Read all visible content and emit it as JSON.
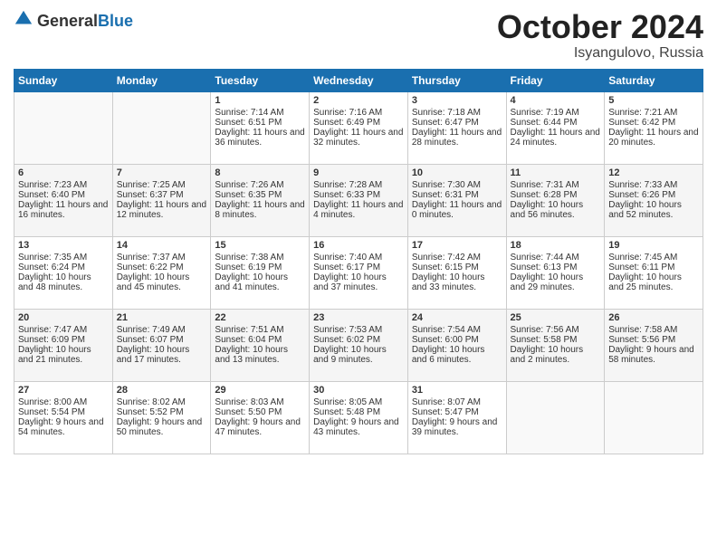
{
  "header": {
    "logo_general": "General",
    "logo_blue": "Blue",
    "month_title": "October 2024",
    "location": "Isyangulovo, Russia"
  },
  "weekdays": [
    "Sunday",
    "Monday",
    "Tuesday",
    "Wednesday",
    "Thursday",
    "Friday",
    "Saturday"
  ],
  "weeks": [
    [
      {
        "day": "",
        "sunrise": "",
        "sunset": "",
        "daylight": ""
      },
      {
        "day": "",
        "sunrise": "",
        "sunset": "",
        "daylight": ""
      },
      {
        "day": "1",
        "sunrise": "Sunrise: 7:14 AM",
        "sunset": "Sunset: 6:51 PM",
        "daylight": "Daylight: 11 hours and 36 minutes."
      },
      {
        "day": "2",
        "sunrise": "Sunrise: 7:16 AM",
        "sunset": "Sunset: 6:49 PM",
        "daylight": "Daylight: 11 hours and 32 minutes."
      },
      {
        "day": "3",
        "sunrise": "Sunrise: 7:18 AM",
        "sunset": "Sunset: 6:47 PM",
        "daylight": "Daylight: 11 hours and 28 minutes."
      },
      {
        "day": "4",
        "sunrise": "Sunrise: 7:19 AM",
        "sunset": "Sunset: 6:44 PM",
        "daylight": "Daylight: 11 hours and 24 minutes."
      },
      {
        "day": "5",
        "sunrise": "Sunrise: 7:21 AM",
        "sunset": "Sunset: 6:42 PM",
        "daylight": "Daylight: 11 hours and 20 minutes."
      }
    ],
    [
      {
        "day": "6",
        "sunrise": "Sunrise: 7:23 AM",
        "sunset": "Sunset: 6:40 PM",
        "daylight": "Daylight: 11 hours and 16 minutes."
      },
      {
        "day": "7",
        "sunrise": "Sunrise: 7:25 AM",
        "sunset": "Sunset: 6:37 PM",
        "daylight": "Daylight: 11 hours and 12 minutes."
      },
      {
        "day": "8",
        "sunrise": "Sunrise: 7:26 AM",
        "sunset": "Sunset: 6:35 PM",
        "daylight": "Daylight: 11 hours and 8 minutes."
      },
      {
        "day": "9",
        "sunrise": "Sunrise: 7:28 AM",
        "sunset": "Sunset: 6:33 PM",
        "daylight": "Daylight: 11 hours and 4 minutes."
      },
      {
        "day": "10",
        "sunrise": "Sunrise: 7:30 AM",
        "sunset": "Sunset: 6:31 PM",
        "daylight": "Daylight: 11 hours and 0 minutes."
      },
      {
        "day": "11",
        "sunrise": "Sunrise: 7:31 AM",
        "sunset": "Sunset: 6:28 PM",
        "daylight": "Daylight: 10 hours and 56 minutes."
      },
      {
        "day": "12",
        "sunrise": "Sunrise: 7:33 AM",
        "sunset": "Sunset: 6:26 PM",
        "daylight": "Daylight: 10 hours and 52 minutes."
      }
    ],
    [
      {
        "day": "13",
        "sunrise": "Sunrise: 7:35 AM",
        "sunset": "Sunset: 6:24 PM",
        "daylight": "Daylight: 10 hours and 48 minutes."
      },
      {
        "day": "14",
        "sunrise": "Sunrise: 7:37 AM",
        "sunset": "Sunset: 6:22 PM",
        "daylight": "Daylight: 10 hours and 45 minutes."
      },
      {
        "day": "15",
        "sunrise": "Sunrise: 7:38 AM",
        "sunset": "Sunset: 6:19 PM",
        "daylight": "Daylight: 10 hours and 41 minutes."
      },
      {
        "day": "16",
        "sunrise": "Sunrise: 7:40 AM",
        "sunset": "Sunset: 6:17 PM",
        "daylight": "Daylight: 10 hours and 37 minutes."
      },
      {
        "day": "17",
        "sunrise": "Sunrise: 7:42 AM",
        "sunset": "Sunset: 6:15 PM",
        "daylight": "Daylight: 10 hours and 33 minutes."
      },
      {
        "day": "18",
        "sunrise": "Sunrise: 7:44 AM",
        "sunset": "Sunset: 6:13 PM",
        "daylight": "Daylight: 10 hours and 29 minutes."
      },
      {
        "day": "19",
        "sunrise": "Sunrise: 7:45 AM",
        "sunset": "Sunset: 6:11 PM",
        "daylight": "Daylight: 10 hours and 25 minutes."
      }
    ],
    [
      {
        "day": "20",
        "sunrise": "Sunrise: 7:47 AM",
        "sunset": "Sunset: 6:09 PM",
        "daylight": "Daylight: 10 hours and 21 minutes."
      },
      {
        "day": "21",
        "sunrise": "Sunrise: 7:49 AM",
        "sunset": "Sunset: 6:07 PM",
        "daylight": "Daylight: 10 hours and 17 minutes."
      },
      {
        "day": "22",
        "sunrise": "Sunrise: 7:51 AM",
        "sunset": "Sunset: 6:04 PM",
        "daylight": "Daylight: 10 hours and 13 minutes."
      },
      {
        "day": "23",
        "sunrise": "Sunrise: 7:53 AM",
        "sunset": "Sunset: 6:02 PM",
        "daylight": "Daylight: 10 hours and 9 minutes."
      },
      {
        "day": "24",
        "sunrise": "Sunrise: 7:54 AM",
        "sunset": "Sunset: 6:00 PM",
        "daylight": "Daylight: 10 hours and 6 minutes."
      },
      {
        "day": "25",
        "sunrise": "Sunrise: 7:56 AM",
        "sunset": "Sunset: 5:58 PM",
        "daylight": "Daylight: 10 hours and 2 minutes."
      },
      {
        "day": "26",
        "sunrise": "Sunrise: 7:58 AM",
        "sunset": "Sunset: 5:56 PM",
        "daylight": "Daylight: 9 hours and 58 minutes."
      }
    ],
    [
      {
        "day": "27",
        "sunrise": "Sunrise: 8:00 AM",
        "sunset": "Sunset: 5:54 PM",
        "daylight": "Daylight: 9 hours and 54 minutes."
      },
      {
        "day": "28",
        "sunrise": "Sunrise: 8:02 AM",
        "sunset": "Sunset: 5:52 PM",
        "daylight": "Daylight: 9 hours and 50 minutes."
      },
      {
        "day": "29",
        "sunrise": "Sunrise: 8:03 AM",
        "sunset": "Sunset: 5:50 PM",
        "daylight": "Daylight: 9 hours and 47 minutes."
      },
      {
        "day": "30",
        "sunrise": "Sunrise: 8:05 AM",
        "sunset": "Sunset: 5:48 PM",
        "daylight": "Daylight: 9 hours and 43 minutes."
      },
      {
        "day": "31",
        "sunrise": "Sunrise: 8:07 AM",
        "sunset": "Sunset: 5:47 PM",
        "daylight": "Daylight: 9 hours and 39 minutes."
      },
      {
        "day": "",
        "sunrise": "",
        "sunset": "",
        "daylight": ""
      },
      {
        "day": "",
        "sunrise": "",
        "sunset": "",
        "daylight": ""
      }
    ]
  ]
}
